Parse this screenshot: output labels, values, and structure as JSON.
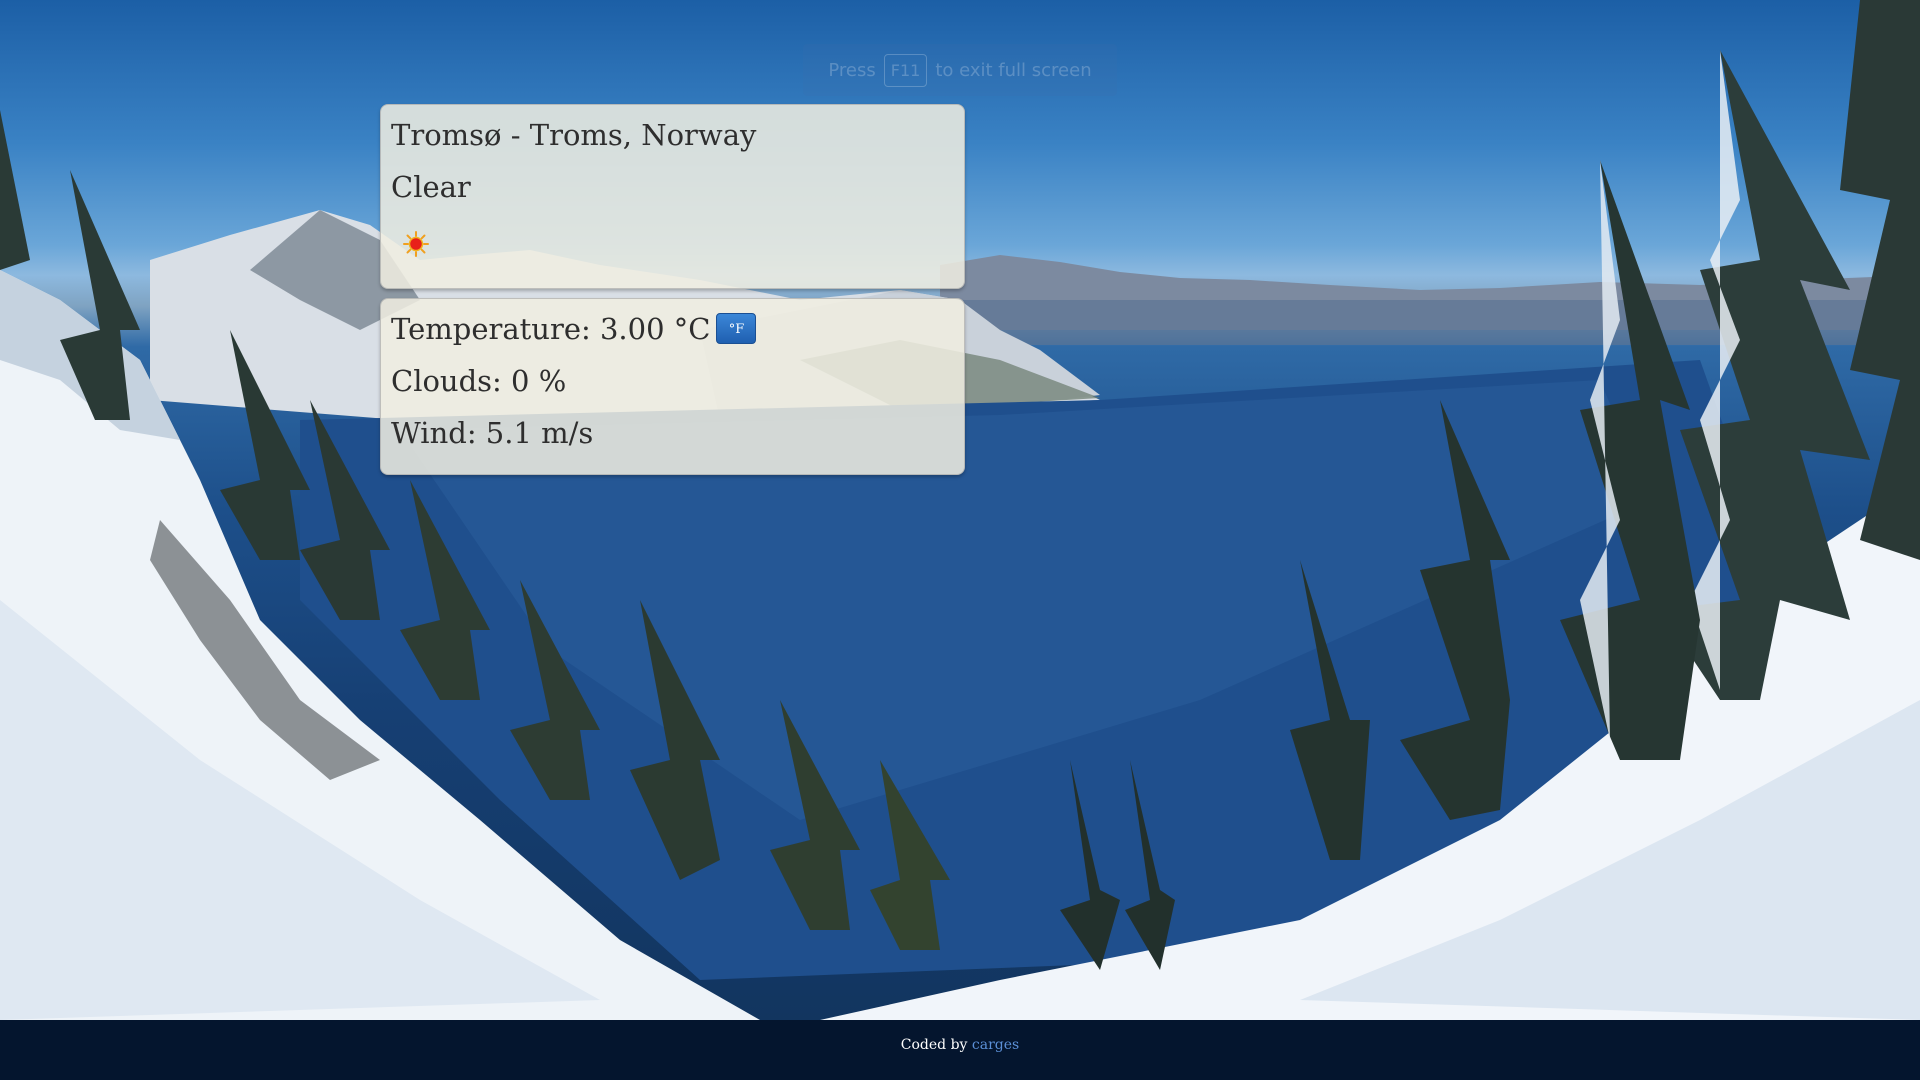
{
  "fullscreen_hint": {
    "prefix": "Press",
    "key": "F11",
    "suffix": "to exit full screen"
  },
  "weather": {
    "location": "Tromsø - Troms, Norway",
    "condition": "Clear",
    "condition_icon": "sun-icon",
    "temperature_label": "Temperature: 3.00 °C",
    "unit_toggle_label": "°F",
    "clouds_label": "Clouds: 0 %",
    "wind_label": "Wind: 5.1 m/s"
  },
  "footer": {
    "prefix": "Coded by",
    "author_link": "carges"
  },
  "colors": {
    "footer_bg": "#04152e",
    "link": "#5b8fd6",
    "button": "#2a6fc4",
    "panel_bg": "#f0eee1"
  }
}
